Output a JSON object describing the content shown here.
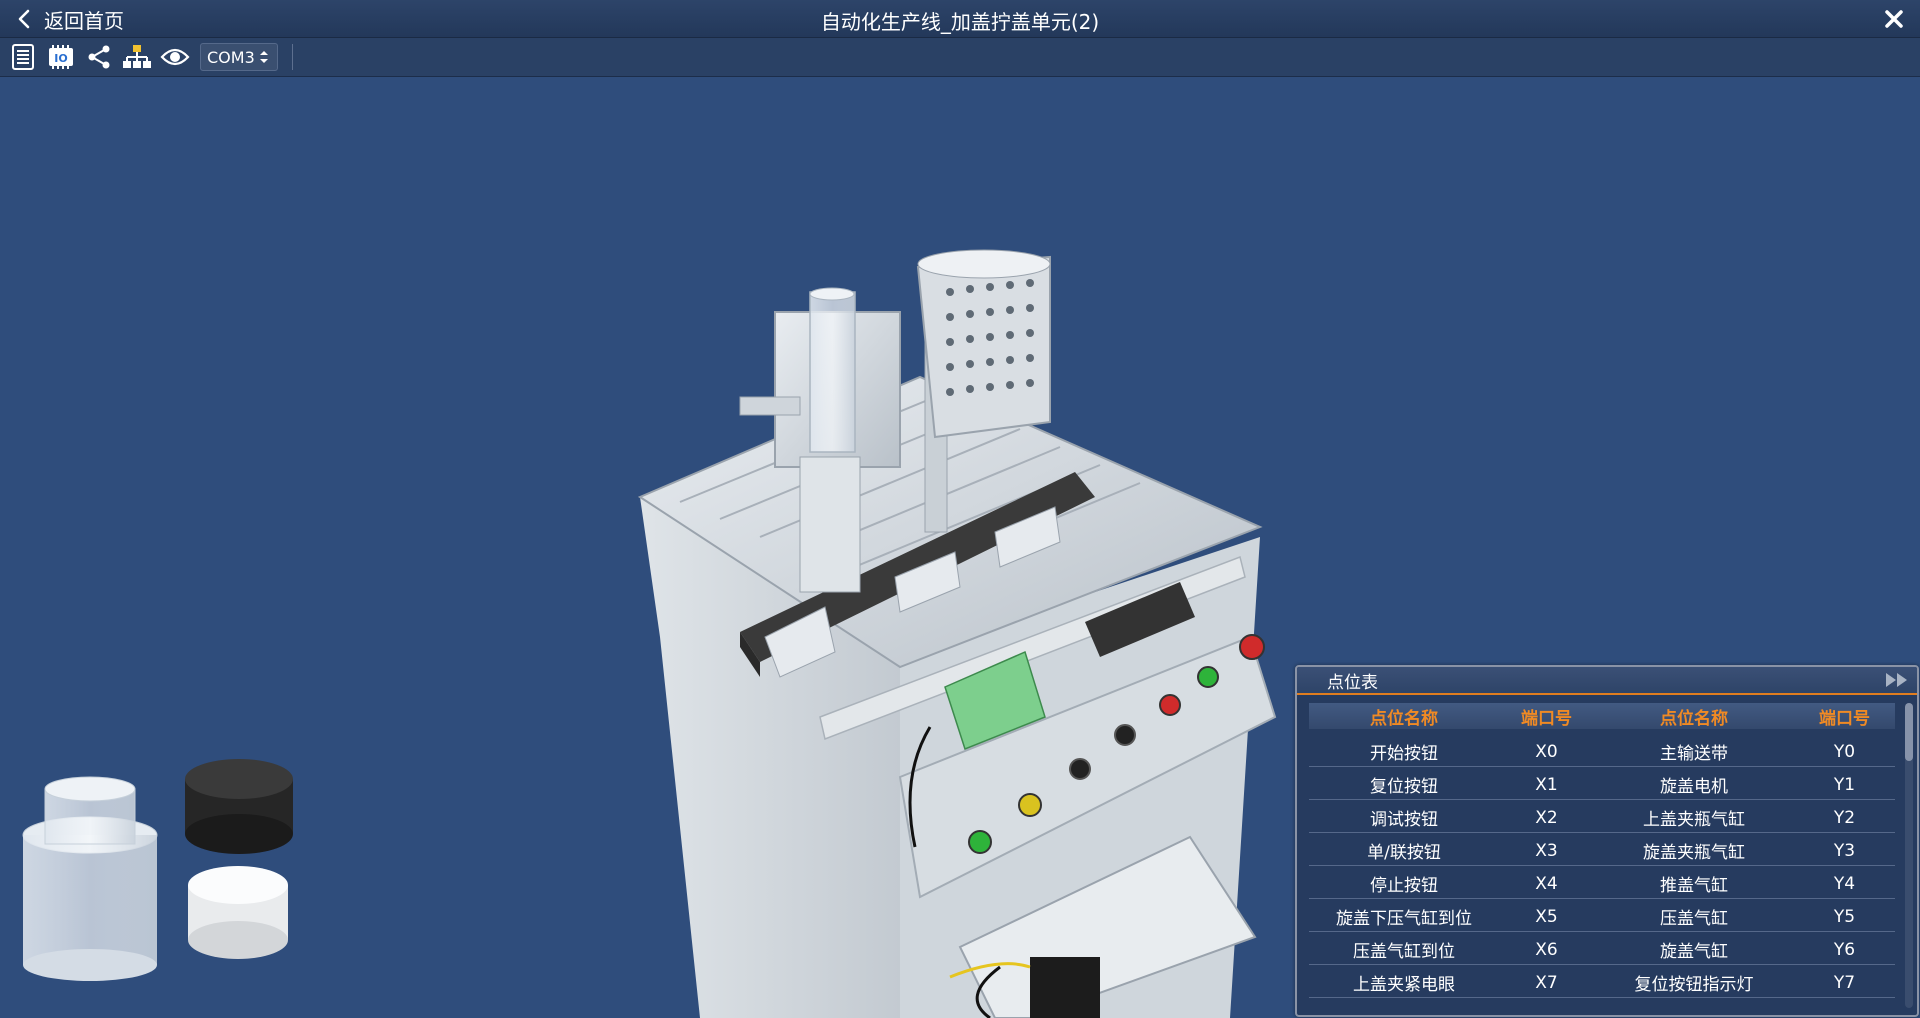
{
  "window": {
    "back_label": "返回首页",
    "title": "自动化生产线_加盖拧盖单元(2)"
  },
  "toolbar": {
    "icons": [
      "list-icon",
      "io-chip-icon",
      "share-icon",
      "network-icon",
      "eye-icon"
    ],
    "io_chip_text": "IO",
    "com_port": "COM3"
  },
  "point_table": {
    "title": "点位表",
    "headers": [
      "点位名称",
      "端口号",
      "点位名称",
      "端口号"
    ],
    "rows": [
      {
        "in_name": "开始按钮",
        "in_port": "X0",
        "out_name": "主输送带",
        "out_port": "Y0"
      },
      {
        "in_name": "复位按钮",
        "in_port": "X1",
        "out_name": "旋盖电机",
        "out_port": "Y1"
      },
      {
        "in_name": "调试按钮",
        "in_port": "X2",
        "out_name": "上盖夹瓶气缸",
        "out_port": "Y2"
      },
      {
        "in_name": "单/联按钮",
        "in_port": "X3",
        "out_name": "旋盖夹瓶气缸",
        "out_port": "Y3"
      },
      {
        "in_name": "停止按钮",
        "in_port": "X4",
        "out_name": "推盖气缸",
        "out_port": "Y4"
      },
      {
        "in_name": "旋盖下压气缸到位",
        "in_port": "X5",
        "out_name": "压盖气缸",
        "out_port": "Y5"
      },
      {
        "in_name": "压盖气缸到位",
        "in_port": "X6",
        "out_name": "旋盖气缸",
        "out_port": "Y6"
      },
      {
        "in_name": "上盖夹紧电眼",
        "in_port": "X7",
        "out_name": "复位按钮指示灯",
        "out_port": "Y7"
      }
    ]
  },
  "colors": {
    "background": "#2f4d7c",
    "header_accent": "#e07d1f",
    "column_header_text": "#f08a24"
  }
}
